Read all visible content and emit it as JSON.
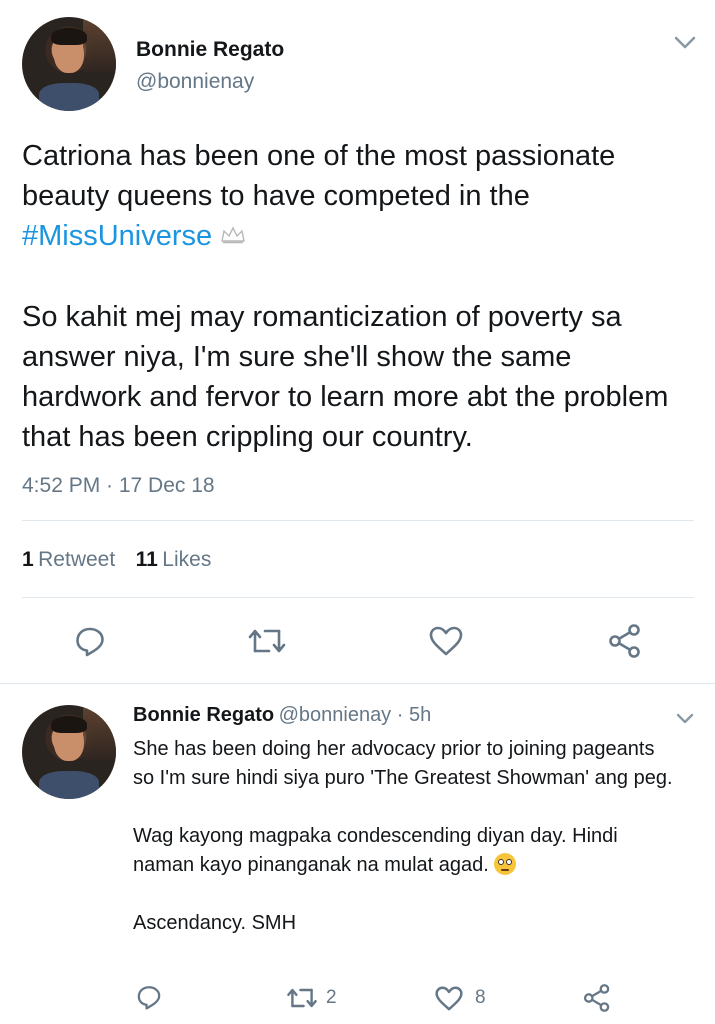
{
  "tweet": {
    "author_name": "Bonnie Regato",
    "author_handle": "@bonnienay",
    "text_before_tag": "Catriona has been one of the most passionate beauty queens to have competed in the ",
    "hashtag": "#MissUniverse",
    "crown_emoji": "👑",
    "text_after_tag": "\n\nSo kahit mej may romanticization of poverty sa answer niya, I'm sure she'll show the same hardwork and fervor to learn more abt the problem that has been crippling our country.",
    "timestamp": "4:52 PM · 17 Dec 18",
    "retweet_count": "1",
    "retweet_label": "Retweet",
    "like_count": "11",
    "like_label": "Likes"
  },
  "reply": {
    "author_name": "Bonnie Regato",
    "author_handle": "@bonnienay",
    "time": " · 5h",
    "text": "She has been doing her advocacy prior to joining pageants so I'm sure hindi siya puro 'The Greatest Showman' ang peg.\n\nWag kayong magpaka condescending diyan day. Hindi naman kayo pinanganak na mulat agad. ",
    "text_end": "\n\nAscendancy. SMH",
    "retweet_count": "2",
    "like_count": "8"
  },
  "icons": {
    "chevron": "chevron-down-icon",
    "reply": "reply-icon",
    "retweet": "retweet-icon",
    "like": "heart-icon",
    "share": "share-icon"
  },
  "colors": {
    "accent": "#1b95e0",
    "secondary_text": "#657786",
    "divider": "#e1e8ed"
  }
}
